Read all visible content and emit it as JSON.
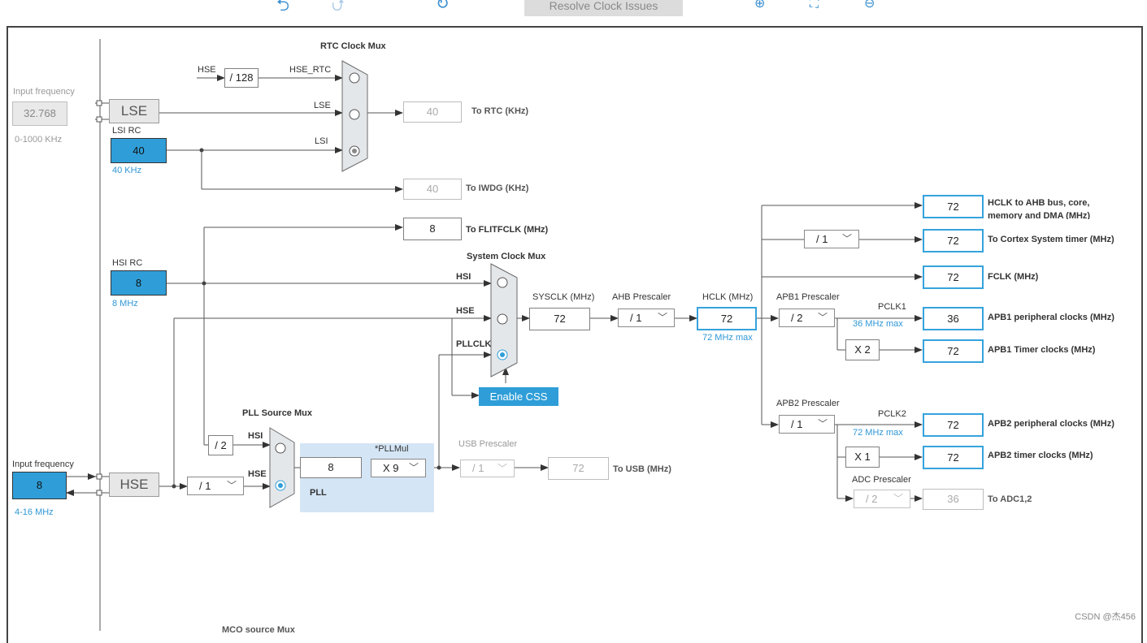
{
  "toolbar": {
    "undo_icon": "undo-icon",
    "redo_icon": "redo-icon",
    "refresh_icon": "refresh-icon",
    "resolve_label": "Resolve Clock Issues",
    "zoom_in_icon": "zoom-in-icon",
    "fit_icon": "fit-to-screen-icon",
    "zoom_out_icon": "zoom-out-icon"
  },
  "lse": {
    "input_freq_label": "Input frequency",
    "input_value": "32.768",
    "range": "0-1000 KHz",
    "osc_label": "LSE"
  },
  "lsi": {
    "title": "LSI RC",
    "value": "40",
    "freq": "40 KHz"
  },
  "rtc": {
    "mux_title": "RTC Clock Mux",
    "hse_in": "HSE",
    "div": "/ 128",
    "hse_rtc": "HSE_RTC",
    "lse_in": "LSE",
    "lsi_in": "LSI",
    "out_value": "40",
    "out_label": "To RTC (KHz)"
  },
  "iwdg": {
    "value": "40",
    "label": "To IWDG (KHz)"
  },
  "flitf": {
    "value": "8",
    "label": "To FLITFCLK (MHz)"
  },
  "hsi": {
    "title": "HSI RC",
    "value": "8",
    "freq": "8 MHz"
  },
  "sysmux": {
    "title": "System Clock Mux",
    "hsi": "HSI",
    "hse": "HSE",
    "pllclk": "PLLCLK",
    "enable_css": "Enable CSS"
  },
  "sysclk": {
    "label": "SYSCLK (MHz)",
    "value": "72"
  },
  "ahb": {
    "label": "AHB Prescaler",
    "value": "/ 1"
  },
  "hclk": {
    "label": "HCLK (MHz)",
    "value": "72",
    "max": "72 MHz max"
  },
  "outputs": {
    "hclk_ahb": {
      "value": "72",
      "label": "HCLK to AHB bus, core,",
      "label2": "memory and DMA (MHz)"
    },
    "cortex": {
      "div": "/ 1",
      "value": "72",
      "label": "To Cortex System timer (MHz)"
    },
    "fclk": {
      "value": "72",
      "label": "FCLK (MHz)"
    }
  },
  "apb1": {
    "title": "APB1 Prescaler",
    "div": "/ 2",
    "pclk": "PCLK1",
    "max": "36 MHz max",
    "periph_value": "36",
    "periph_label": "APB1 peripheral clocks (MHz)",
    "timer_mult": "X 2",
    "timer_value": "72",
    "timer_label": "APB1 Timer clocks (MHz)"
  },
  "apb2": {
    "title": "APB2 Prescaler",
    "div": "/ 1",
    "pclk": "PCLK2",
    "max": "72 MHz max",
    "periph_value": "72",
    "periph_label": "APB2 peripheral clocks (MHz)",
    "timer_mult": "X 1",
    "timer_value": "72",
    "timer_label": "APB2 timer clocks (MHz)"
  },
  "adc": {
    "title": "ADC Prescaler",
    "div": "/ 2",
    "value": "36",
    "label": "To ADC1,2"
  },
  "pll": {
    "src_title": "PLL Source Mux",
    "div2": "/ 2",
    "hsi": "HSI",
    "hse": "HSE",
    "value": "8",
    "mul_title": "*PLLMul",
    "mul": "X 9",
    "label": "PLL"
  },
  "usb": {
    "title": "USB Prescaler",
    "div": "/ 1",
    "value": "72",
    "label": "To USB (MHz)"
  },
  "hse": {
    "input_freq_label": "Input frequency",
    "value": "8",
    "range": "4-16 MHz",
    "osc_label": "HSE",
    "div": "/ 1"
  },
  "mco": {
    "title": "MCO source Mux"
  },
  "watermark": "CSDN @杰456",
  "colors": {
    "accent_blue": "#2f9ed8",
    "output_border": "#35a3dd",
    "pll_area": "#d4e5f5"
  }
}
